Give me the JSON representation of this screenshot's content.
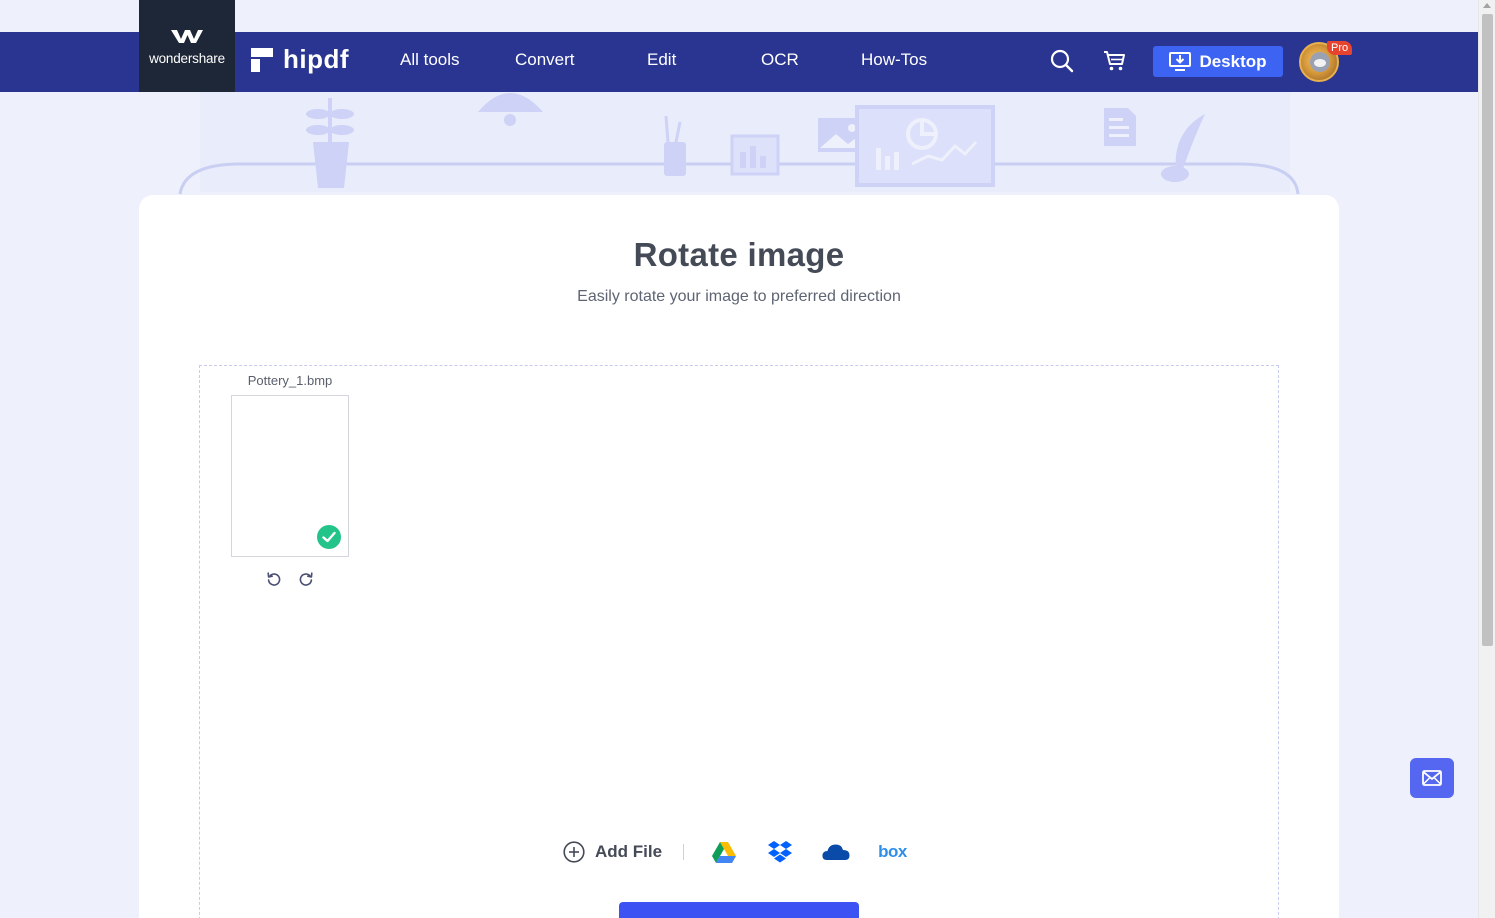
{
  "brand": {
    "company": "wondershare",
    "product": "hipdf"
  },
  "nav": {
    "items": [
      {
        "label": "All tools"
      },
      {
        "label": "Convert"
      },
      {
        "label": "Edit"
      },
      {
        "label": "OCR"
      },
      {
        "label": "How-Tos"
      }
    ],
    "desktop_label": "Desktop",
    "pro_badge": "Pro"
  },
  "tool": {
    "title": "Rotate image",
    "subtitle": "Easily rotate your image to preferred direction"
  },
  "files": [
    {
      "name": "Pottery_1.bmp",
      "status": "uploaded"
    }
  ],
  "actions": {
    "add_file_label": "Add File",
    "cloud_sources": [
      "google-drive",
      "dropbox",
      "onedrive",
      "box"
    ],
    "box_label": "box"
  },
  "colors": {
    "navbar": "#2a3591",
    "accent": "#3d63f2",
    "success": "#23c48a",
    "page_bg": "#eef0fb"
  }
}
